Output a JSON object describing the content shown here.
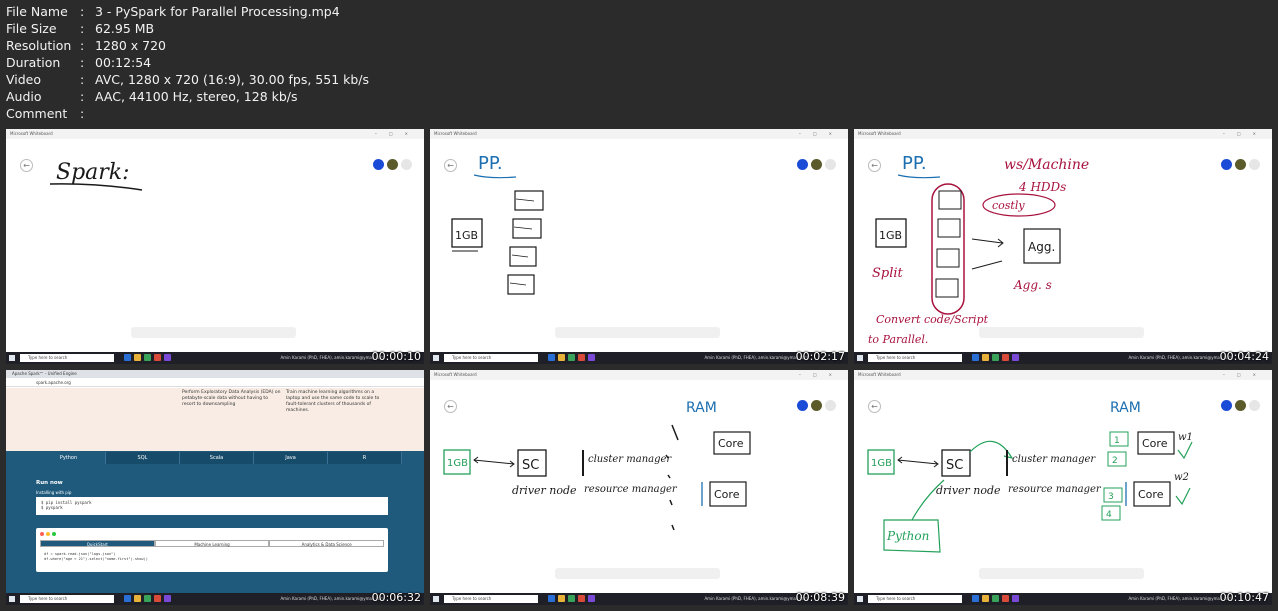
{
  "file_info": {
    "rows": [
      {
        "key": "File Name",
        "sep": ":",
        "value": "3 - PySpark for Parallel Processing.mp4"
      },
      {
        "key": "File Size",
        "sep": ":",
        "value": "62.95 MB"
      },
      {
        "key": "Resolution",
        "sep": ":",
        "value": "1280 x 720"
      },
      {
        "key": "Duration",
        "sep": ":",
        "value": "00:12:54"
      },
      {
        "key": "Video",
        "sep": ":",
        "value": "AVC, 1280 x 720 (16:9), 30.00 fps, 551 kb/s"
      },
      {
        "key": "Audio",
        "sep": ":",
        "value": "AAC, 44100 Hz, stereo, 128 kb/s"
      },
      {
        "key": "Comment",
        "sep": ":",
        "value": ""
      }
    ]
  },
  "thumbnails": [
    {
      "timestamp": "00:00:10",
      "window_title": "Microsoft Whiteboard",
      "search_text": "Type here to search",
      "user": "Amin Karami (PhD, FHEA), amin.karami@ymail.com"
    },
    {
      "timestamp": "00:02:17",
      "window_title": "Microsoft Whiteboard",
      "search_text": "Type here to search",
      "user": "Amin Karami (PhD, FHEA), amin.karami@ymail.com"
    },
    {
      "timestamp": "00:04:24",
      "window_title": "Microsoft Whiteboard",
      "search_text": "Type here to search",
      "user": "Amin Karami (PhD, FHEA), amin.karami@ymail.com"
    },
    {
      "timestamp": "00:06:32",
      "window_title": "Apache Spark",
      "search_text": "Type here to search",
      "user": "Amin Karami (PhD, FHEA), amin.karami@ymail.com"
    },
    {
      "timestamp": "00:08:39",
      "window_title": "Microsoft Whiteboard",
      "search_text": "Type here to search",
      "user": "Amin Karami (PhD, FHEA), amin.karami@ymail.com"
    },
    {
      "timestamp": "00:10:47",
      "window_title": "Microsoft Whiteboard",
      "search_text": "Type here to search",
      "user": "Amin Karami (PhD, FHEA), amin.karami@ymail.com"
    }
  ],
  "spark_page": {
    "tab_title": "Apache Spark™ - Unified Engine",
    "url": "spark.apache.org",
    "col1": "Perform Exploratory Data Analysis (EDA) on petabyte-scale data without having to resort to downsampling",
    "col2": "Train machine learning algorithms on a laptop and use the same code to scale to fault-tolerant clusters of thousands of machines.",
    "lang_tabs": [
      "Python",
      "SQL",
      "Scala",
      "Java",
      "R"
    ],
    "run_now": "Run now",
    "install_label": "Installing with pip",
    "install_code": [
      "$ pip install pyspark",
      "$ pyspark"
    ],
    "editor_tabs": [
      "QuickStart",
      "Machine Learning",
      "Analytics & Data Science"
    ],
    "editor_code": [
      "df = spark.read.json(\"logs.json\")",
      "df.where(\"age > 21\").select(\"name.first\").show()"
    ]
  },
  "ink_text": {
    "spark": "Spark:",
    "pp": "PP.",
    "one_gb": "1GB",
    "ws_machine": "ws/Machine",
    "four_hdds": "4 HDDs",
    "costly": "costly",
    "agg": "Agg.",
    "aggs": "Agg. s",
    "split": "Split",
    "convert_code": "Convert code/Script",
    "to_parallel": "to Parallel.",
    "ram": "RAM",
    "sc": "SC",
    "driver_node": "driver node",
    "cluster_manager": "cluster manager",
    "resource_manager": "resource manager",
    "core": "Core",
    "python": "Python",
    "w1": "w1",
    "w2": "w2"
  },
  "colors": {
    "background": "#2b2b2b",
    "ink_black": "#1a1a1a",
    "ink_blue": "#1c6fb0",
    "ink_red": "#a8123e",
    "ink_green": "#23a15a",
    "spark_blue": "#1f5a7d"
  }
}
